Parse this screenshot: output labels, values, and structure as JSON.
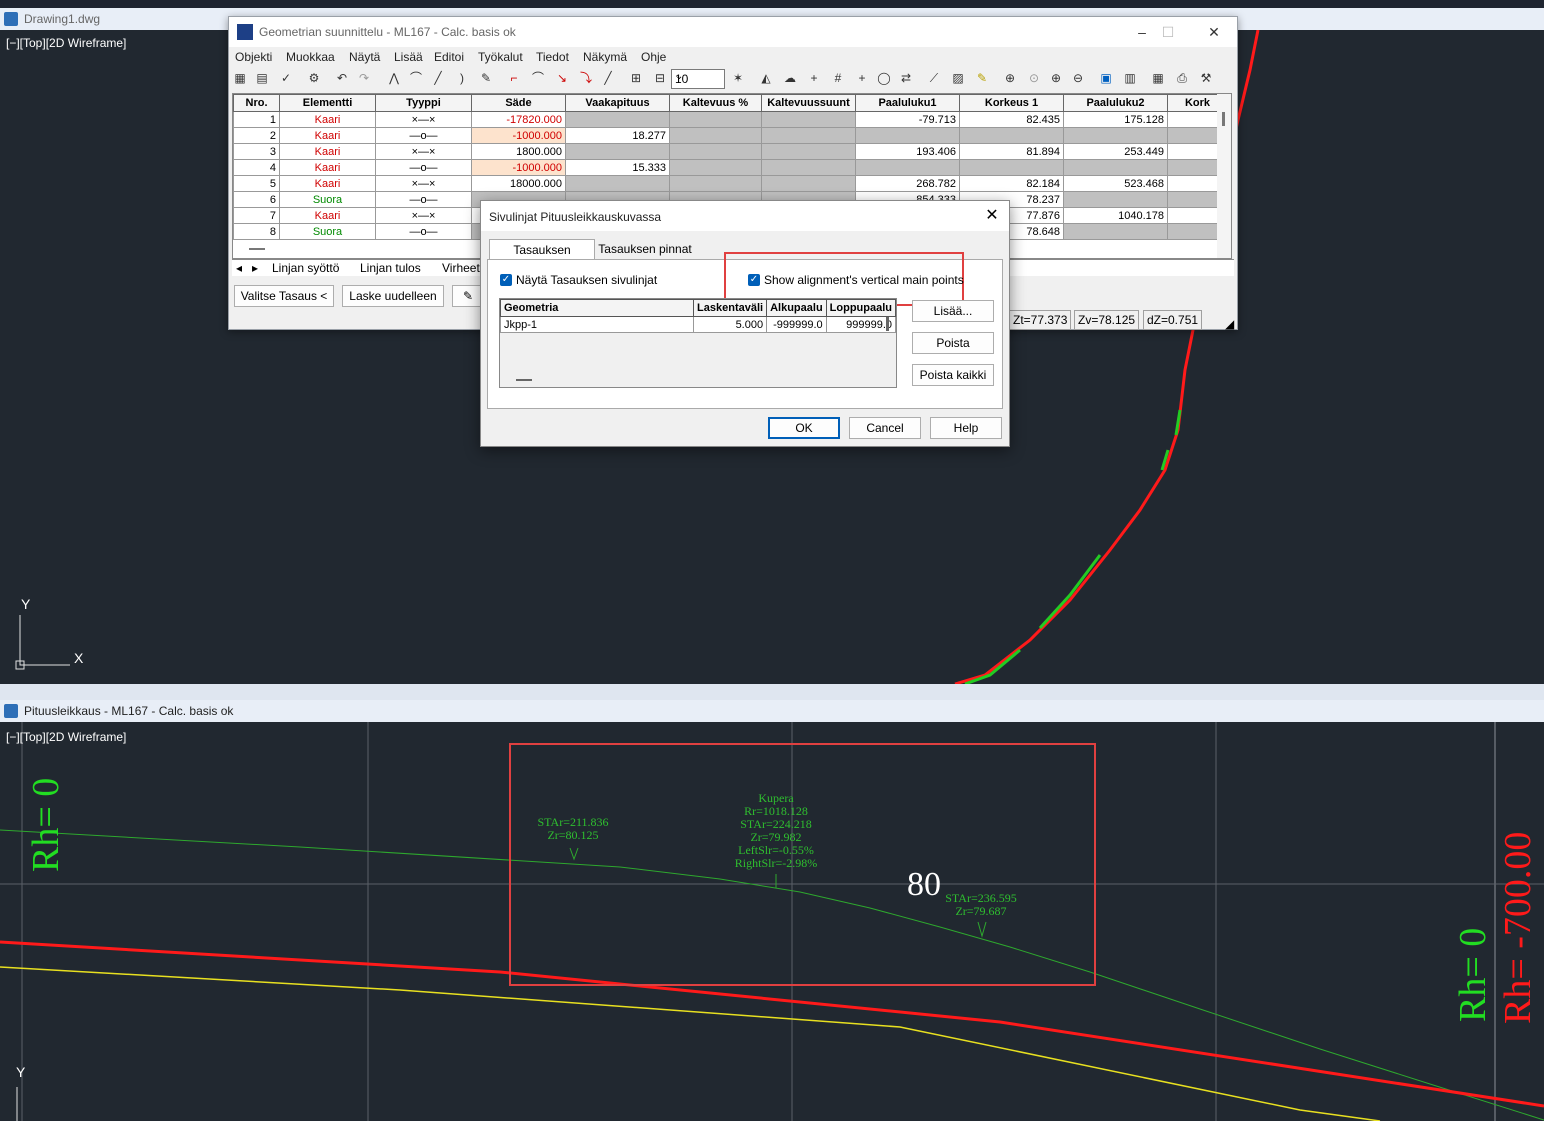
{
  "top_cad": {
    "title": "Drawing1.dwg",
    "view_label": "[−][Top][2D Wireframe]",
    "axis_y": "Y",
    "axis_x": "X"
  },
  "main_window": {
    "title": "Geometrian suunnittelu - ML167 - Calc. basis ok",
    "menu": [
      "Objekti",
      "Muokkaa",
      "Näytä",
      "Lisää",
      "Editoi",
      "Työkalut",
      "Tiedot",
      "Näkymä",
      "Ohje"
    ],
    "zoom_value": "10",
    "columns": [
      "Nro.",
      "Elementti",
      "Tyyppi",
      "Säde",
      "Vaakapituus",
      "Kaltevuus %",
      "Kaltevuussuunt",
      "Paaluluku1",
      "Korkeus 1",
      "Paaluluku2",
      "Kork"
    ],
    "rows": [
      {
        "nro": "1",
        "elementti": "Kaari",
        "kind": "arc",
        "sade": "-17820.000",
        "vaaka": "",
        "paalu1": "-79.713",
        "kork1": "82.435",
        "paalu2": "175.128"
      },
      {
        "nro": "2",
        "elementti": "Kaari",
        "kind": "arc",
        "sade": "-1000.000",
        "vaaka": "18.277",
        "paalu1": "",
        "kork1": "",
        "paalu2": ""
      },
      {
        "nro": "3",
        "elementti": "Kaari",
        "kind": "arc",
        "sade": "1800.000",
        "vaaka": "",
        "paalu1": "193.406",
        "kork1": "81.894",
        "paalu2": "253.449"
      },
      {
        "nro": "4",
        "elementti": "Kaari",
        "kind": "arc",
        "sade": "-1000.000",
        "vaaka": "15.333",
        "paalu1": "",
        "kork1": "",
        "paalu2": ""
      },
      {
        "nro": "5",
        "elementti": "Kaari",
        "kind": "arc",
        "sade": "18000.000",
        "vaaka": "",
        "paalu1": "268.782",
        "kork1": "82.184",
        "paalu2": "523.468"
      },
      {
        "nro": "6",
        "elementti": "Suora",
        "kind": "line",
        "sade": "",
        "vaaka": "",
        "paalu1": "854.333",
        "kork1": "78.237",
        "paalu2": ""
      },
      {
        "nro": "7",
        "elementti": "Kaari",
        "kind": "arc",
        "sade": "",
        "vaaka": "",
        "paalu1": "",
        "kork1": "77.876",
        "paalu2": "1040.178"
      },
      {
        "nro": "8",
        "elementti": "Suora",
        "kind": "line",
        "sade": "",
        "vaaka": "",
        "paalu1": "",
        "kork1": "78.648",
        "paalu2": ""
      }
    ],
    "bottom_tabs": [
      "Linjan syöttö",
      "Linjan tulos",
      "Virheet"
    ],
    "buttons": {
      "valitse": "Valitse Tasaus <",
      "laske": "Laske uudelleen"
    },
    "status": {
      "zt": "Zt=77.373",
      "zv": "Zv=78.125",
      "dz": "dZ=0.751"
    }
  },
  "modal": {
    "title": "Sivulinjat Pituusleikkauskuvassa",
    "tabs": [
      "Tasauksen sivulinjat",
      "Tasauksen pinnat"
    ],
    "check1": "Näytä Tasauksen sivulinjat",
    "check2": "Show alignment's vertical main points",
    "columns": [
      "Geometria",
      "Laskentaväli",
      "Alkupaalu",
      "Loppupaalu"
    ],
    "rows": [
      {
        "geom": "Jkpp-1",
        "lask": "5.000",
        "alku": "-999999.0",
        "loppu": "999999.0"
      }
    ],
    "side_buttons": [
      "Lisää...",
      "Poista",
      "Poista kaikki"
    ],
    "buttons": {
      "ok": "OK",
      "cancel": "Cancel",
      "help": "Help"
    }
  },
  "bottom_cad": {
    "title": "Pituusleikkaus - ML167 - Calc. basis ok",
    "view_label": "[−][Top][2D Wireframe]",
    "rh_left": "Rh= 0",
    "rh_right_green": "Rh= 0",
    "rh_right_red": "Rh= -700.00",
    "grid_label": "80",
    "label_a": [
      "STAr=211.836",
      "Zr=80.125"
    ],
    "label_b": [
      "Kupera",
      "Rr=1018.128",
      "STAr=224.218",
      "Zr=79.982",
      "LeftSlr=-0.55%",
      "RightSlr=-2.98%"
    ],
    "label_c": [
      "STAr=236.595",
      "Zr=79.687"
    ],
    "axis_y": "Y"
  },
  "colors": {
    "highlight": "#e04040",
    "alignment_red": "#ff1a1a",
    "alignment_green": "#22cc22",
    "yellow_line": "#e8e020"
  }
}
